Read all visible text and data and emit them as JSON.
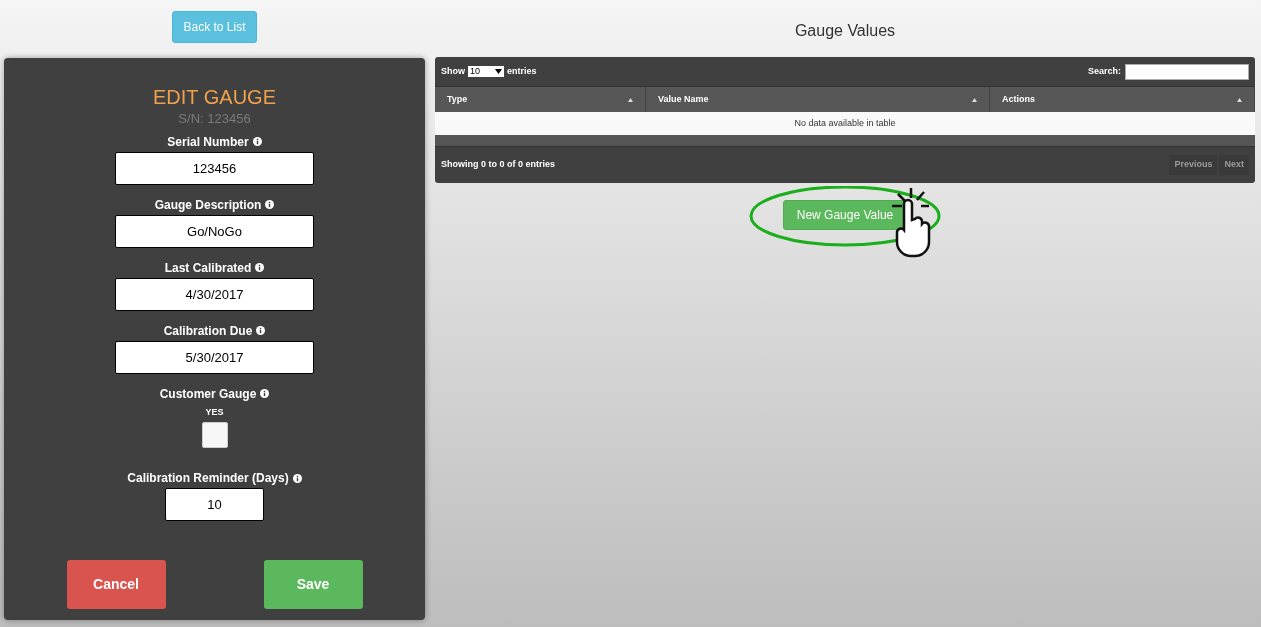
{
  "back_button": "Back to List",
  "form": {
    "title": "EDIT GAUGE",
    "subtitle": "S/N: 123456",
    "fields": [
      {
        "kind": "text",
        "label": "Serial Number",
        "value": "123456"
      },
      {
        "kind": "text",
        "label": "Gauge Description",
        "value": "Go/NoGo"
      },
      {
        "kind": "text",
        "label": "Last Calibrated",
        "value": "4/30/2017"
      },
      {
        "kind": "text",
        "label": "Calibration Due",
        "value": "5/30/2017"
      },
      {
        "kind": "checkbox",
        "label": "Customer Gauge",
        "option": "YES",
        "checked": false
      },
      {
        "kind": "short",
        "label": "Calibration Reminder (Days)",
        "value": "10"
      }
    ],
    "buttons": [
      {
        "kind": "cancel",
        "label": "Cancel"
      },
      {
        "kind": "save",
        "label": "Save"
      }
    ]
  },
  "values_panel": {
    "title": "Gauge Values",
    "show_label": "Show",
    "page_size": "10",
    "entries_label": "entries",
    "search_label": "Search:",
    "columns": [
      "Type",
      "Value Name",
      "Actions"
    ],
    "empty_message": "No data available in table",
    "info": "Showing 0 to 0 of 0 entries",
    "pager": [
      {
        "label": "Previous",
        "disabled": true
      },
      {
        "label": "Next",
        "disabled": true
      }
    ],
    "new_button": "New Gauge Value",
    "highlighted": true
  }
}
